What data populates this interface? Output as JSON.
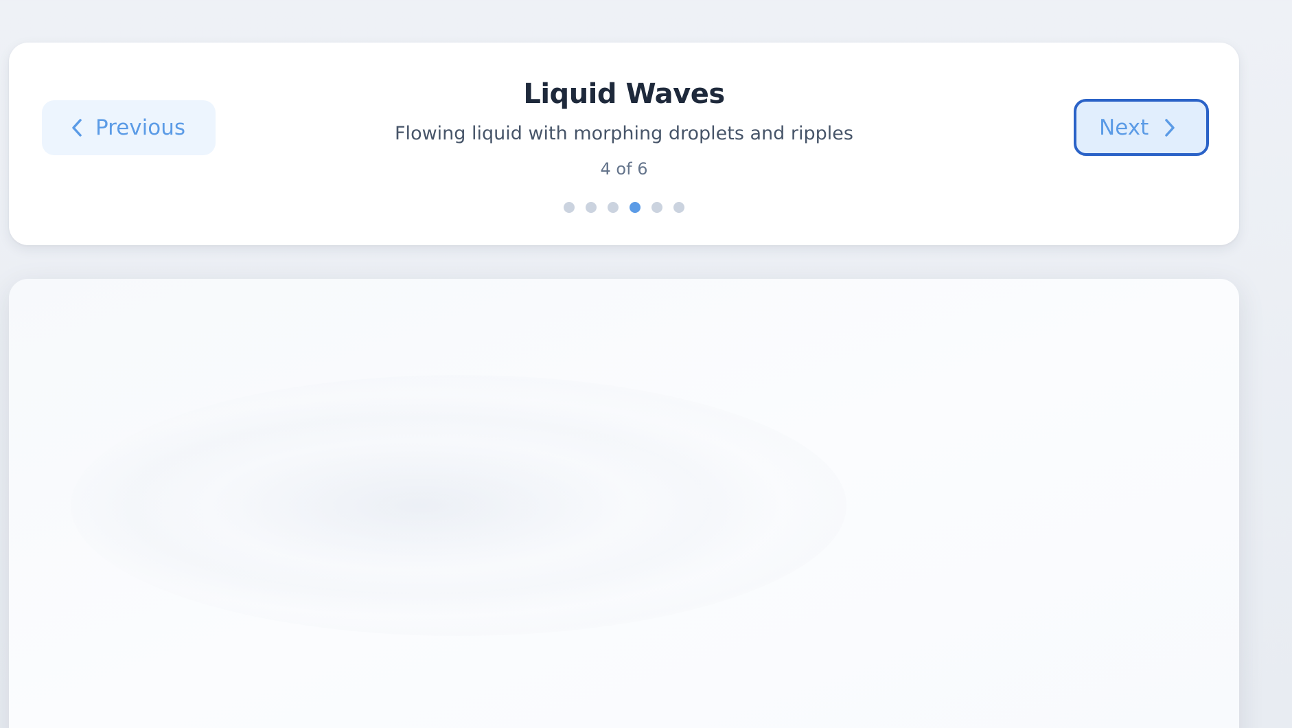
{
  "slide": {
    "title": "Liquid Waves",
    "description": "Flowing liquid with morphing droplets and ripples",
    "counter": "4 of 6",
    "current_index": 4,
    "total": 6
  },
  "nav": {
    "previous_label": "Previous",
    "next_label": "Next",
    "previous_icon": "chevron-left-icon",
    "next_icon": "chevron-right-icon"
  },
  "colors": {
    "accent": "#5b9be6",
    "focus_border": "#2a62c7",
    "title": "#1e293b",
    "dot_inactive": "#cbd3df"
  }
}
